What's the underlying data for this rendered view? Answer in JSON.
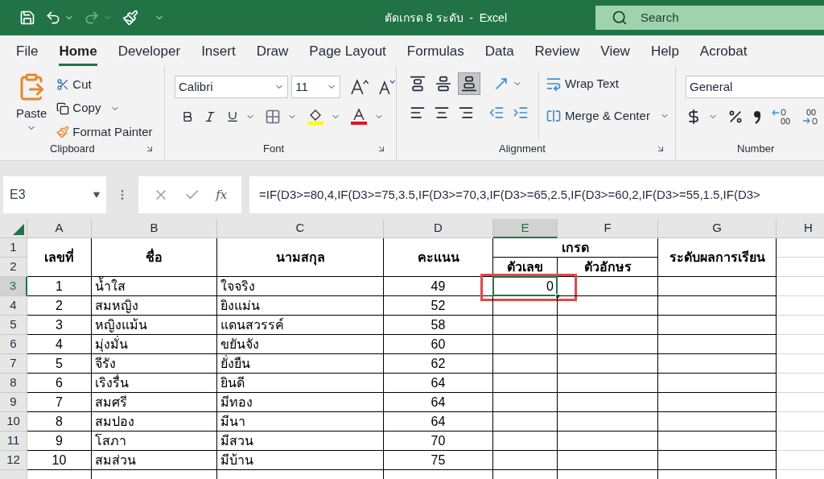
{
  "title_bar": {
    "title": "ตัดเกรด 8 ระดับ  -  Excel",
    "search_placeholder": "Search"
  },
  "menu_tabs": [
    {
      "label": "File",
      "selected": false
    },
    {
      "label": "Home",
      "selected": true
    },
    {
      "label": "Developer",
      "selected": false
    },
    {
      "label": "Insert",
      "selected": false
    },
    {
      "label": "Draw",
      "selected": false
    },
    {
      "label": "Page Layout",
      "selected": false
    },
    {
      "label": "Formulas",
      "selected": false
    },
    {
      "label": "Data",
      "selected": false
    },
    {
      "label": "Review",
      "selected": false
    },
    {
      "label": "View",
      "selected": false
    },
    {
      "label": "Help",
      "selected": false
    },
    {
      "label": "Acrobat",
      "selected": false
    }
  ],
  "ribbon": {
    "clipboard": {
      "paste": "Paste",
      "cut": "Cut",
      "copy": "Copy",
      "format_painter": "Format Painter",
      "group": "Clipboard"
    },
    "font": {
      "name": "Calibri",
      "size": "11",
      "group": "Font"
    },
    "alignment": {
      "vertical_align": [
        {
          "selected": false
        },
        {
          "selected": false
        },
        {
          "selected": true
        }
      ],
      "wrap_text": "Wrap Text",
      "merge_center": "Merge & Center",
      "group": "Alignment"
    },
    "number": {
      "format": "General",
      "group": "Number"
    }
  },
  "formula_bar": {
    "name_box": "E3",
    "function_button": "fx",
    "formula": "=IF(D3>=80,4,IF(D3>=75,3.5,IF(D3>=70,3,IF(D3>=65,2.5,IF(D3>=60,2,IF(D3>=55,1.5,IF(D3>"
  },
  "columns": [
    {
      "label": "A",
      "selected": false
    },
    {
      "label": "B",
      "selected": false
    },
    {
      "label": "C",
      "selected": false
    },
    {
      "label": "D",
      "selected": false
    },
    {
      "label": "E",
      "selected": true
    },
    {
      "label": "F",
      "selected": false
    },
    {
      "label": "G",
      "selected": false
    },
    {
      "label": "H",
      "selected": false
    }
  ],
  "header": {
    "row_labels": [
      "1",
      "2"
    ],
    "number": "เลขที่",
    "first_name": "ชื่อ",
    "last_name": "นามสกุล",
    "score": "คะแนน",
    "grade": "เกรด",
    "grade_number": "ตัวเลข",
    "grade_letter": "ตัวอักษร",
    "result_level": "ระดับผลการเรียน"
  },
  "rows": [
    {
      "row": "3",
      "selected": true,
      "number": "1",
      "first_name": "น้ำใส",
      "last_name": "ใจจริง",
      "score": "49",
      "grade_number": "0"
    },
    {
      "row": "4",
      "selected": false,
      "number": "2",
      "first_name": "สมหญิง",
      "last_name": "ยิงแม่น",
      "score": "52"
    },
    {
      "row": "5",
      "selected": false,
      "number": "3",
      "first_name": "หญิงแม้น",
      "last_name": "แดนสวรรค์",
      "score": "58"
    },
    {
      "row": "6",
      "selected": false,
      "number": "4",
      "first_name": "มุ่งมั่น",
      "last_name": "ขยันจัง",
      "score": "60"
    },
    {
      "row": "7",
      "selected": false,
      "number": "5",
      "first_name": "จีรัง",
      "last_name": "ยั่งยืน",
      "score": "62"
    },
    {
      "row": "8",
      "selected": false,
      "number": "6",
      "first_name": "เริงรื่น",
      "last_name": "ยินดี",
      "score": "64"
    },
    {
      "row": "9",
      "selected": false,
      "number": "7",
      "first_name": "สมศรี",
      "last_name": "มีทอง",
      "score": "64"
    },
    {
      "row": "10",
      "selected": false,
      "number": "8",
      "first_name": "สมปอง",
      "last_name": "มีนา",
      "score": "64"
    },
    {
      "row": "11",
      "selected": false,
      "number": "9",
      "first_name": "โสภา",
      "last_name": "มีสวน",
      "score": "70"
    },
    {
      "row": "12",
      "selected": false,
      "number": "10",
      "first_name": "สมส่วน",
      "last_name": "มีบ้าน",
      "score": "75"
    }
  ]
}
